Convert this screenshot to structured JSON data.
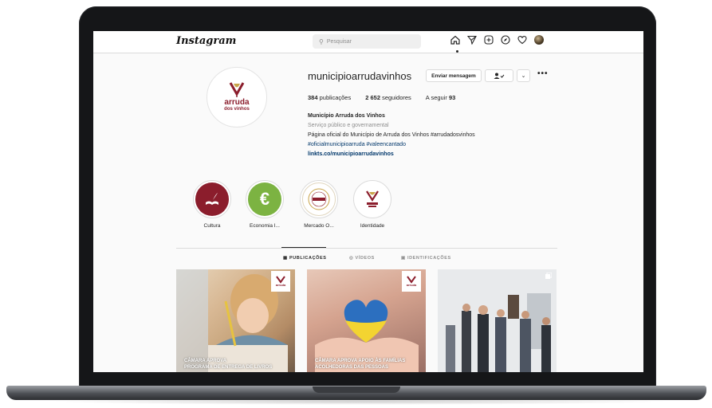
{
  "header": {
    "logo": "Instagram",
    "search_placeholder": "Pesquisar"
  },
  "profile": {
    "username": "municipioarrudavinhos",
    "message_button": "Enviar mensagem",
    "posts_count": "384",
    "posts_label": "publicações",
    "followers_count": "2 652",
    "followers_label": "seguidores",
    "following_label": "A seguir",
    "following_count": "93",
    "full_name": "Município Arruda dos Vinhos",
    "category": "Serviço público e governamental",
    "bio_line1": "Página oficial do Município de Arruda dos Vinhos #arrudadosvinhos",
    "bio_line2": "#oficialmunicipioarruda #valeencantado",
    "link": "linkts.co/municipioarrudavinhos",
    "avatar_brand": "arruda",
    "avatar_sub": "dos vinhos"
  },
  "highlights": [
    {
      "label": "Cultura",
      "color": "#8b1d2c"
    },
    {
      "label": "Economia I...",
      "color": "#7cb342"
    },
    {
      "label": "Mercado O...",
      "color": "#ffffff"
    },
    {
      "label": "Identidade",
      "color": "#ffffff"
    }
  ],
  "tabs": [
    {
      "label": "PUBLICAÇÕES",
      "icon": "grid-icon",
      "active": true
    },
    {
      "label": "VÍDEOS",
      "icon": "video-icon",
      "active": false
    },
    {
      "label": "IDENTIFICAÇÕES",
      "icon": "tag-icon",
      "active": false
    }
  ],
  "posts": [
    {
      "caption1": "CÂMARA APROVA",
      "caption2": "PROGRAMA DE ENTREGA DE LIVROS"
    },
    {
      "caption1": "CÂMARA APROVA APOIO ÀS FAMÍLIAS",
      "caption2": "ACOLHEDORAS DAS PESSOAS"
    },
    {
      "caption1": "",
      "caption2": ""
    }
  ],
  "colors": {
    "brand": "#8b1d2c",
    "link": "#00376b"
  }
}
